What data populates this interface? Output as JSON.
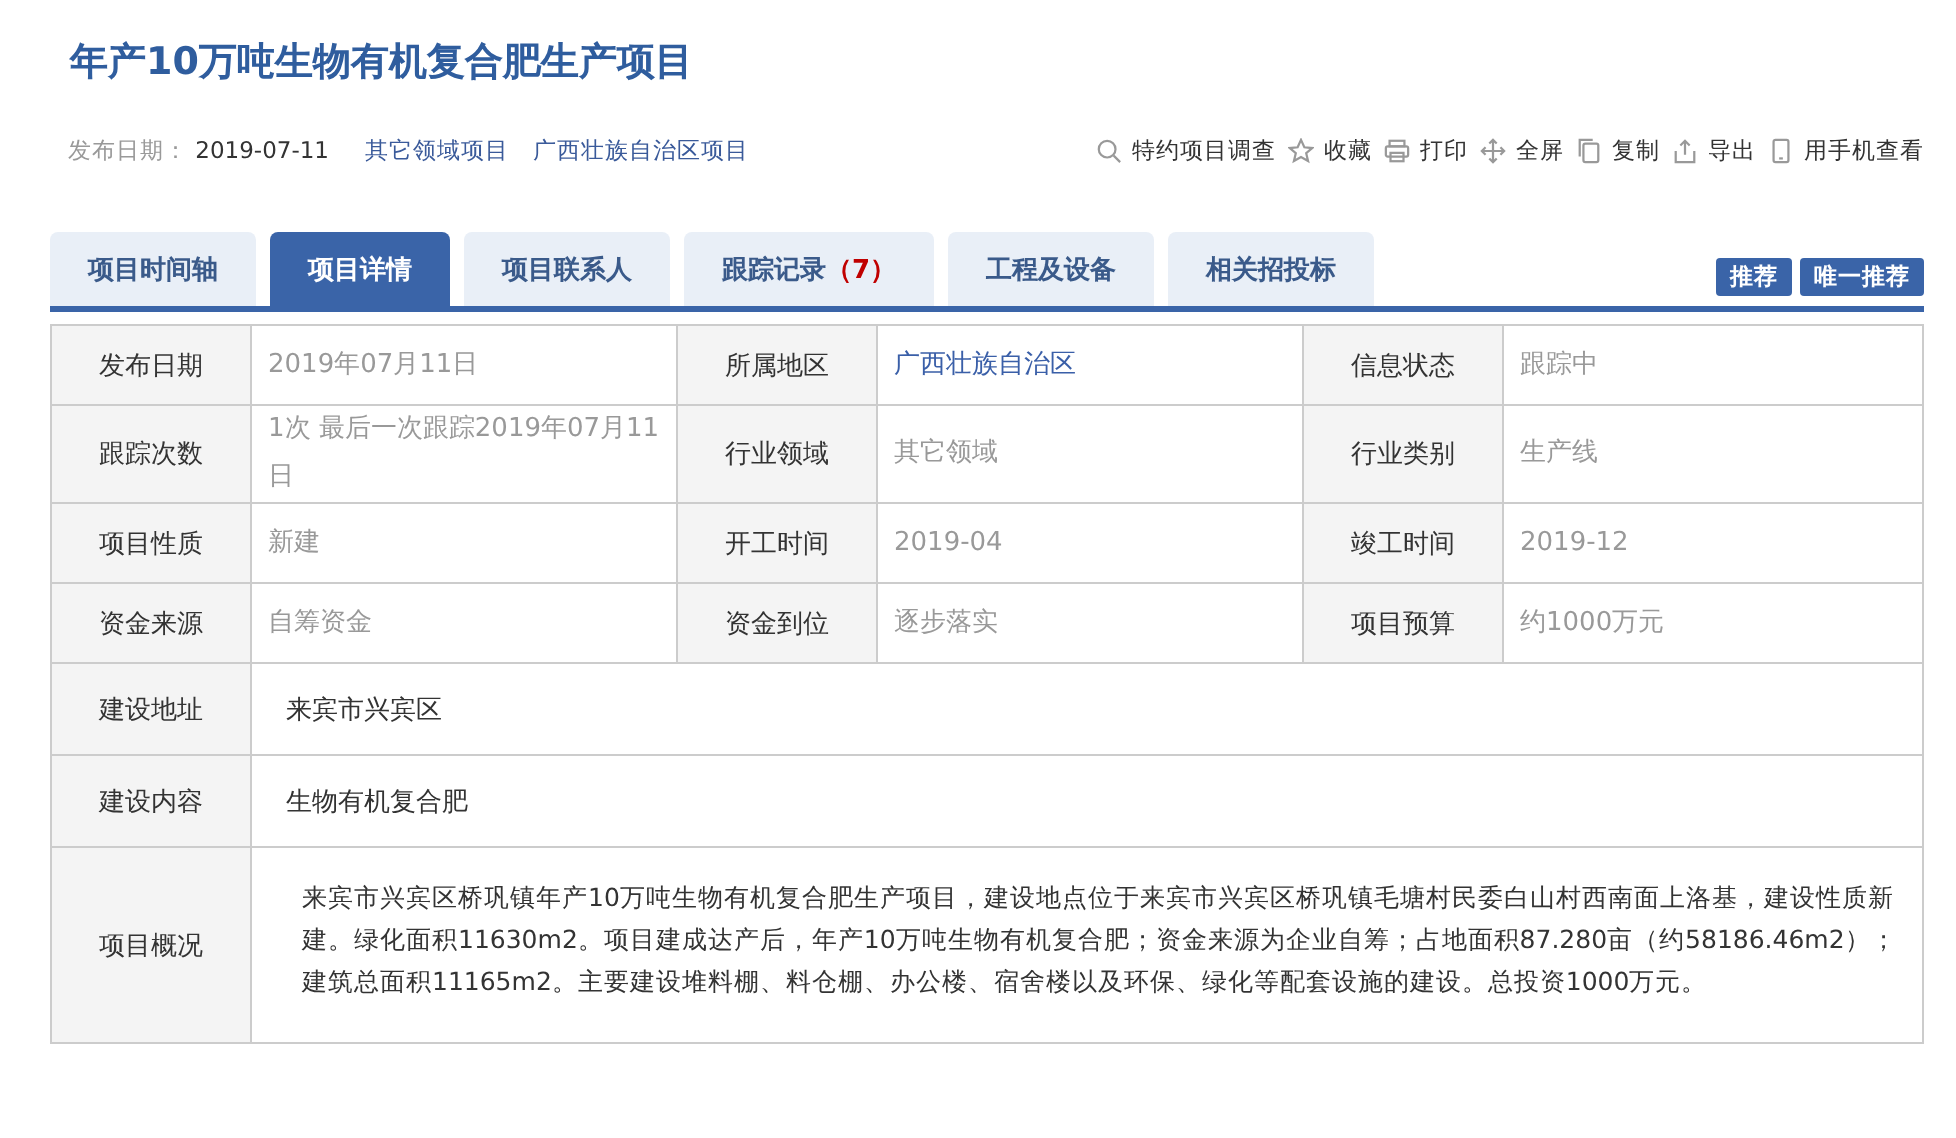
{
  "title": "年产10万吨生物有机复合肥生产项目",
  "meta": {
    "date_label": "发布日期：",
    "date": "2019-07-11",
    "tags": [
      "其它领域项目",
      "广西壮族自治区项目"
    ]
  },
  "actions": [
    {
      "kind": "search",
      "label": "特约项目调查"
    },
    {
      "kind": "star",
      "label": "收藏"
    },
    {
      "kind": "print",
      "label": "打印"
    },
    {
      "kind": "move",
      "label": "全屏"
    },
    {
      "kind": "copy",
      "label": "复制"
    },
    {
      "kind": "export",
      "label": "导出"
    },
    {
      "kind": "phone",
      "label": "用手机查看"
    }
  ],
  "tabs": [
    {
      "label": "项目时间轴",
      "selected": false
    },
    {
      "label": "项目详情",
      "selected": true
    },
    {
      "label": "项目联系人",
      "selected": false
    },
    {
      "label": "跟踪记录",
      "count": "（7）",
      "selected": false
    },
    {
      "label": "工程及设备",
      "selected": false
    },
    {
      "label": "相关招投标",
      "selected": false
    }
  ],
  "buttons": [
    "推荐",
    "唯一推荐"
  ],
  "table": {
    "rows": [
      {
        "cells": [
          {
            "label": "发布日期",
            "value": "2019年07月11日",
            "kind": "text"
          },
          {
            "label": "所属地区",
            "value": "广西壮族自治区",
            "kind": "link"
          },
          {
            "label": "信息状态",
            "value": "跟踪中",
            "kind": "text"
          }
        ]
      },
      {
        "cells": [
          {
            "label": "跟踪次数",
            "value": "1次 最后一次跟踪2019年07月11日",
            "kind": "text"
          },
          {
            "label": "行业领域",
            "value": "其它领域",
            "kind": "text"
          },
          {
            "label": "行业类别",
            "value": "生产线",
            "kind": "text"
          }
        ]
      },
      {
        "cells": [
          {
            "label": "项目性质",
            "value": "新建",
            "kind": "text"
          },
          {
            "label": "开工时间",
            "value": "2019-04",
            "kind": "text"
          },
          {
            "label": "竣工时间",
            "value": "2019-12",
            "kind": "text"
          }
        ]
      },
      {
        "cells": [
          {
            "label": "资金来源",
            "value": "自筹资金",
            "kind": "text"
          },
          {
            "label": "资金到位",
            "value": "逐步落实",
            "kind": "text"
          },
          {
            "label": "项目预算",
            "value": "约1000万元",
            "kind": "text"
          }
        ]
      }
    ],
    "wide_rows": [
      {
        "label": "建设地址",
        "value": "来宾市兴宾区"
      },
      {
        "label": "建设内容",
        "value": "生物有机复合肥"
      },
      {
        "label": "项目概况",
        "value": "来宾市兴宾区桥巩镇年产10万吨生物有机复合肥生产项目，建设地点位于来宾市兴宾区桥巩镇毛塘村民委白山村西南面上洛基，建设性质新建。绿化面积11630m2。项目建成达产后，年产10万吨生物有机复合肥；资金来源为企业自筹；占地面积87.280亩（约58186.46m2）；建筑总面积11165m2。主要建设堆料棚、料仓棚、办公楼、宿舍楼以及环保、绿化等配套设施的建设。总投资1000万元。",
        "kind": "paragraph"
      }
    ]
  }
}
